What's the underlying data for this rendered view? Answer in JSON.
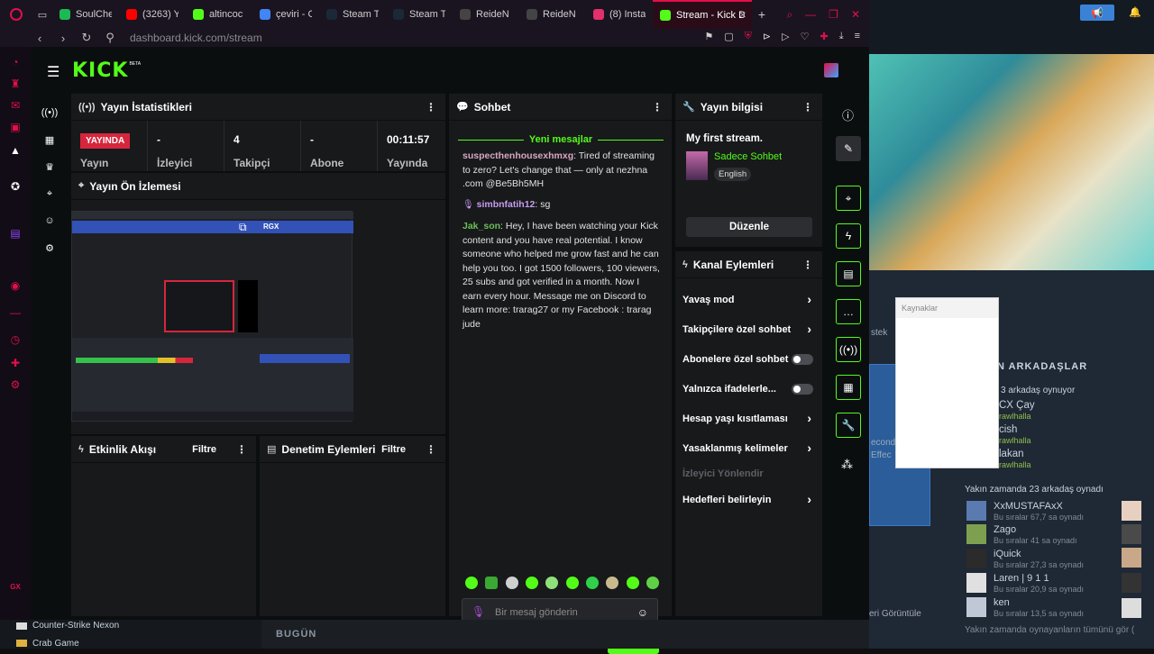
{
  "browser": {
    "tabs": [
      {
        "label": "SoulChef",
        "color": "#1db954"
      },
      {
        "label": "(3263) Yo",
        "color": "#ff0000"
      },
      {
        "label": "altincoc",
        "color": "#53fc18"
      },
      {
        "label": "çeviri - G",
        "color": "#4285f4"
      },
      {
        "label": "Steam Tr",
        "color": "#1b2838"
      },
      {
        "label": "Steam Tr",
        "color": "#1b2838"
      },
      {
        "label": "ReideN -",
        "color": "#444"
      },
      {
        "label": "ReideN -",
        "color": "#444"
      },
      {
        "label": "(8) Instag",
        "color": "#e1306c"
      },
      {
        "label": "Stream - Kick Das",
        "color": "#53fc18"
      }
    ],
    "url": "dashboard.kick.com/stream"
  },
  "kick": {
    "logo": "KICK",
    "logo_badge": "BETA",
    "stats_panel": {
      "title": "Yayın İstatistikleri",
      "live_badge": "YAYINDA",
      "live_label": "Yayın",
      "viewers_value": "-",
      "viewers_label": "İzleyici",
      "followers_value": "4",
      "followers_label": "Takipçi",
      "subs_value": "-",
      "subs_label": "Abone",
      "uptime_value": "00:11:57",
      "uptime_label": "Yayında"
    },
    "preview_panel": {
      "title": "Yayın Ön İzlemesi",
      "overlay_text": "RGX"
    },
    "activity_panel": {
      "title": "Etkinlik Akışı",
      "filter": "Filtre"
    },
    "mod_panel": {
      "title": "Denetim Eylemleri",
      "filter": "Filtre"
    },
    "chat": {
      "title": "Sohbet",
      "new_messages": "Yeni mesajlar",
      "messages": [
        {
          "user": "suspecthenhousexhmxg",
          "text": ": Tired of streaming to zero? Let's change that — only at nezhna .com @Be5Bh5MH"
        },
        {
          "user": "simbnfatih12",
          "text": ": sg"
        },
        {
          "user": "Jak_son",
          "text": ": Hey, I have been watching your Kick content and you have real potential. I know someone who helped me grow fast and he can help you too. I got 1500 followers, 100 viewers, 25 subs and got verified in a month. Now I earn every hour. Message me on Discord to learn more: trarag27 or my Facebook : trarag jude"
        }
      ],
      "input_placeholder": "Bir mesaj gönderin",
      "send_label": "Gönder"
    },
    "stream_info": {
      "title": "Yayın bilgisi",
      "stream_title": "My first stream.",
      "category": "Sadece Sohbet",
      "language": "English",
      "edit_label": "Düzenle"
    },
    "channel_actions": {
      "title": "Kanal Eylemleri",
      "items": [
        {
          "label": "Yavaş mod",
          "kind": "chevron"
        },
        {
          "label": "Takipçilere özel sohbet",
          "kind": "chevron"
        },
        {
          "label": "Abonelere özel sohbet",
          "kind": "toggle"
        },
        {
          "label": "Yalnızca ifadelerle...",
          "kind": "toggle"
        },
        {
          "label": "Hesap yaşı kısıtlaması",
          "kind": "chevron"
        },
        {
          "label": "Yasaklanmış kelimeler",
          "kind": "chevron"
        }
      ],
      "section_label": "İzleyici Yönlendir",
      "goals_label": "Hedefleri belirleyin"
    }
  },
  "steam": {
    "kaynaklar": "Kaynaklar",
    "friends_header": "N ARKADAŞLAR",
    "playing_count": "3 arkadaş oynuyor",
    "playing": [
      {
        "name": "CX Çay",
        "game": "rawlhalla"
      },
      {
        "name": "cish",
        "game": "rawlhalla"
      },
      {
        "name": "lakan",
        "game": "rawlhalla"
      }
    ],
    "recent_header": "Yakın zamanda 23 arkadaş oynadı",
    "recent": [
      {
        "name": "XxMUSTAFAxX",
        "status": "Bu sıralar 67,7 sa oynadı"
      },
      {
        "name": "Zago",
        "status": "Bu sıralar 41 sa oynadı"
      },
      {
        "name": "iQuick",
        "status": "Bu sıralar 27,3 sa oynadı"
      },
      {
        "name": "Laren | 9 1 1",
        "status": "Bu sıralar 20,9 sa oynadı"
      },
      {
        "name": "ken",
        "status": "Bu sıralar 13,5 sa oynadı"
      }
    ],
    "see_all": "Yakın zamanda oynayanların tümünü gör (",
    "side_texts": [
      "stek",
      "econd",
      "Effec"
    ],
    "screens_label": "eri Görüntüle"
  },
  "bottom": {
    "games": [
      "Counter-Strike Nexon",
      "Crab Game"
    ],
    "today": "BUGÜN"
  }
}
